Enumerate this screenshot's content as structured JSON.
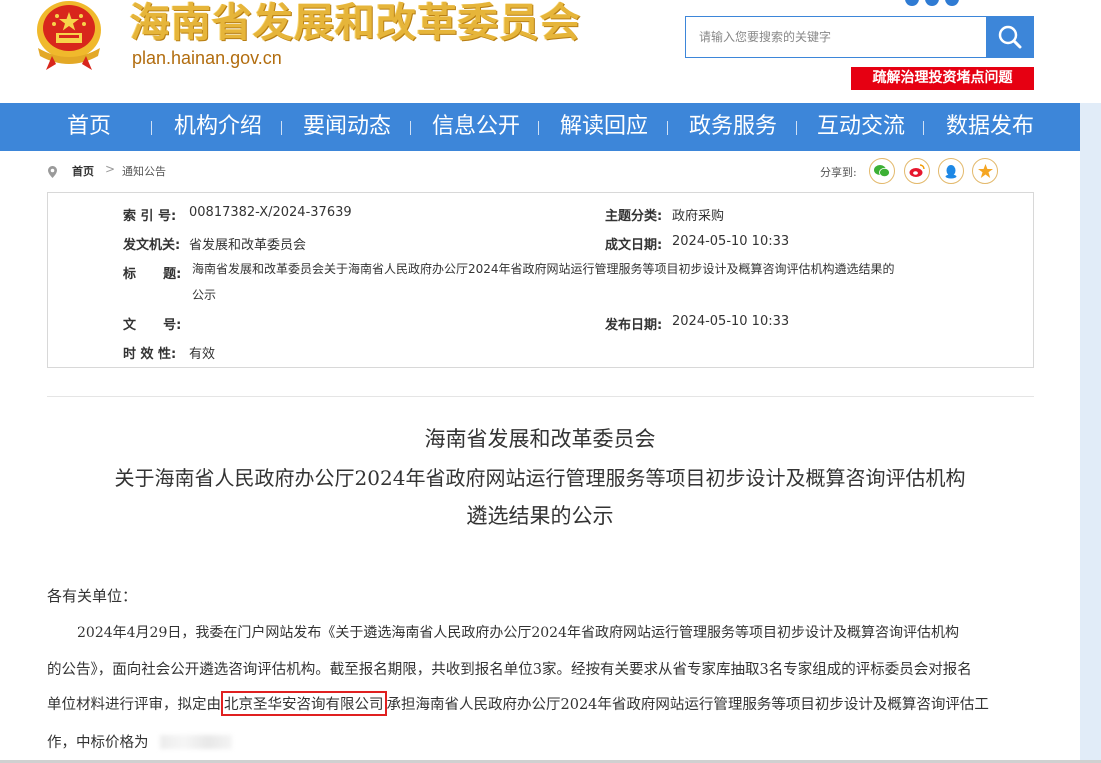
{
  "header": {
    "site_title": "海南省发展和改革委员会",
    "domain": "plan.hainan.gov.cn",
    "search_placeholder": "请输入您要搜索的关键字",
    "promo": "疏解治理投资堵点问题",
    "accent_color": "#3d86d9",
    "promo_color": "#e60012"
  },
  "nav": {
    "items": [
      "首页",
      "机构介绍",
      "要闻动态",
      "信息公开",
      "解读回应",
      "政务服务",
      "互动交流",
      "数据发布"
    ]
  },
  "breadcrumb": {
    "home": "首页",
    "separator": ">",
    "current": "通知公告",
    "share_label": "分享到:",
    "share_icons": [
      "wechat-icon",
      "weibo-icon",
      "qq-icon",
      "qzone-icon"
    ]
  },
  "info": {
    "index_label": "索 引 号:",
    "index_value": "00817382-X/2024-37639",
    "topic_label": "主题分类:",
    "topic_value": "政府采购",
    "issuer_label": "发文机关:",
    "issuer_value": "省发展和改革委员会",
    "date_label": "成文日期:",
    "date_value": "2024-05-10 10:33",
    "title_label": "标      题:",
    "title_line1": "海南省发展和改革委员会关于海南省人民政府办公厅2024年省政府网站运行管理服务等项目初步设计及概算咨询评估机构遴选结果的",
    "title_line2": "公示",
    "docno_label": "文      号:",
    "docno_value": "",
    "pub_label": "发布日期:",
    "pub_value": "2024-05-10 10:33",
    "valid_label": "时 效 性:",
    "valid_value": "有效"
  },
  "article": {
    "title_line1": "海南省发展和改革委员会",
    "title_line2": "关于海南省人民政府办公厅2024年省政府网站运行管理服务等项目初步设计及概算咨询评估机构",
    "title_line3": "遴选结果的公示",
    "salutation": "各有关单位：",
    "p1_line1": "2024年4月29日，我委在门户网站发布《关于遴选海南省人民政府办公厅2024年省政府网站运行管理服务等项目初步设计及概算咨询评估机构",
    "p1_line2": "的公告》，面向社会公开遴选咨询评估机构。截至报名期限，共收到报名单位3家。经按有关要求从省专家库抽取3名专家组成的评标委员会对报名",
    "p1_line3_pre": "单位材料进行评审，拟定由",
    "p1_line3_highlight": "北京圣华安咨询有限公司",
    "p1_line3_post": "承担海南省人民政府办公厅2024年省政府网站运行管理服务等项目初步设计及概算咨询评估工",
    "p1_line4": "作，中标价格为"
  }
}
